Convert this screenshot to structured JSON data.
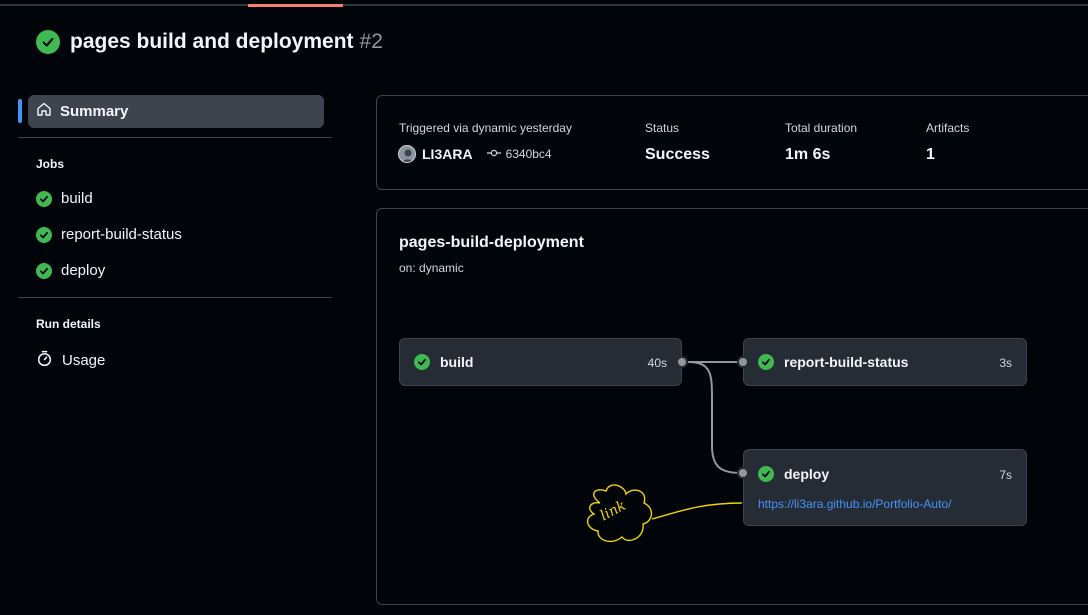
{
  "header": {
    "title": "pages build and deployment",
    "run_number": "#2"
  },
  "sidebar": {
    "summary_label": "Summary",
    "jobs_heading": "Jobs",
    "jobs": [
      {
        "label": "build"
      },
      {
        "label": "report-build-status"
      },
      {
        "label": "deploy"
      }
    ],
    "run_details_heading": "Run details",
    "usage_label": "Usage"
  },
  "summary": {
    "triggered_label": "Triggered via dynamic yesterday",
    "actor": "LI3ARA",
    "commit": "6340bc4",
    "status_label": "Status",
    "status_value": "Success",
    "duration_label": "Total duration",
    "duration_value": "1m 6s",
    "artifacts_label": "Artifacts",
    "artifacts_value": "1"
  },
  "workflow": {
    "name": "pages-build-deployment",
    "trigger": "on: dynamic",
    "nodes": [
      {
        "name": "build",
        "duration": "40s"
      },
      {
        "name": "report-build-status",
        "duration": "3s"
      },
      {
        "name": "deploy",
        "duration": "7s",
        "link": "https://li3ara.github.io/Portfolio-Auto/"
      }
    ]
  },
  "annotation": {
    "text": "link",
    "color": "#f2d400"
  },
  "colors": {
    "success": "#3fb950",
    "accent": "#4493f8",
    "tab_highlight": "#f78166"
  },
  "icons": [
    "check-circle-icon",
    "home-icon",
    "stopwatch-icon",
    "commit-icon",
    "avatar"
  ]
}
